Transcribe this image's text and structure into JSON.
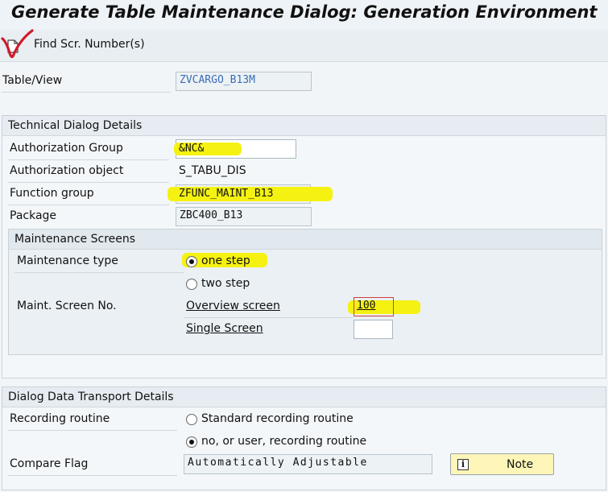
{
  "title": "Generate Table Maintenance Dialog: Generation Environment",
  "toolbar": {
    "find_label": "Find Scr. Number(s)"
  },
  "table_view": {
    "label": "Table/View",
    "value": "ZVCARGO_B13M"
  },
  "technical": {
    "header": "Technical Dialog Details",
    "auth_group_label": "Authorization Group",
    "auth_group_value": "&NC&",
    "auth_object_label": "Authorization object",
    "auth_object_value": "S_TABU_DIS",
    "function_group_label": "Function group",
    "function_group_value": "ZFUNC_MAINT_B13",
    "package_label": "Package",
    "package_value": "ZBC400_B13"
  },
  "maintenance": {
    "header": "Maintenance Screens",
    "type_label": "Maintenance type",
    "one_step": "one step",
    "two_step": "two step",
    "selected": "one step",
    "screen_no_label": "Maint. Screen No.",
    "overview_label": "Overview screen",
    "overview_value": "100",
    "single_label": "Single Screen",
    "single_value": ""
  },
  "transport": {
    "header": "Dialog Data Transport Details",
    "recording_label": "Recording routine",
    "standard_option": "Standard recording routine",
    "user_option": "no, or user, recording routine",
    "selected": "no, or user, recording routine",
    "compare_label": "Compare Flag",
    "compare_value": "Automatically Adjustable",
    "note_label": "Note"
  },
  "colors": {
    "highlight": "#f5f212",
    "link_field": "#3a6db6",
    "annotation_check": "#d11a2a"
  },
  "icons": [
    "document-icon",
    "check-annotation-icon",
    "info-icon"
  ]
}
